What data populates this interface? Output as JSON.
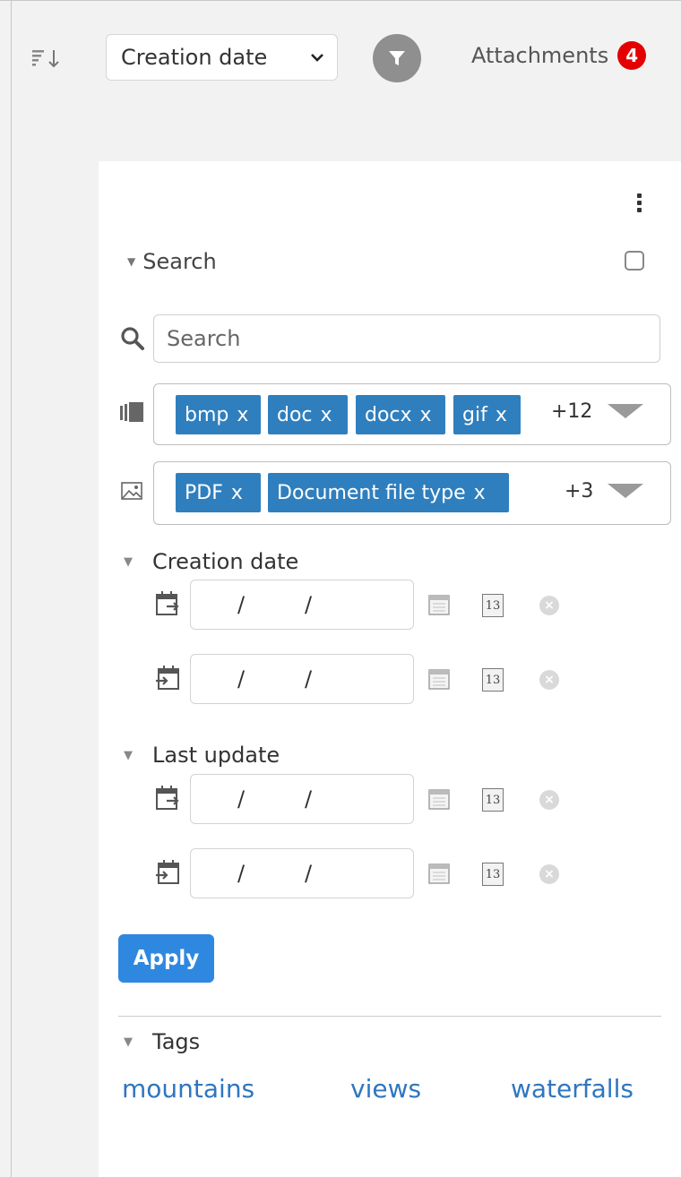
{
  "toolbar": {
    "sort_select": {
      "value": "Creation date"
    },
    "attachments": {
      "label": "Attachments",
      "count": "4"
    }
  },
  "colors": {
    "chip_blue": "#2f7fbe",
    "apply_blue": "#2f88e0",
    "badge_red": "#e40000",
    "link_blue": "#2f76c0"
  },
  "search_section": {
    "title": "Search",
    "search_input": {
      "placeholder": "Search",
      "value": ""
    },
    "file_types": {
      "chips": [
        "bmp",
        "doc",
        "docx",
        "gif"
      ],
      "chip_remove": "x",
      "more": "+12"
    },
    "document_types": {
      "chips": [
        "PDF",
        "Document file type"
      ],
      "chip_remove": "x",
      "more": "+3"
    }
  },
  "date_filters": {
    "creation": {
      "title": "Creation date",
      "from": {
        "sep1": "/",
        "sep2": "/",
        "today_day": "13"
      },
      "to": {
        "sep1": "/",
        "sep2": "/",
        "today_day": "13"
      }
    },
    "update": {
      "title": "Last update",
      "from": {
        "sep1": "/",
        "sep2": "/",
        "today_day": "13"
      },
      "to": {
        "sep1": "/",
        "sep2": "/",
        "today_day": "13"
      }
    }
  },
  "apply_label": "Apply",
  "tags": {
    "title": "Tags",
    "items": [
      "mountains",
      "views",
      "waterfalls"
    ]
  }
}
